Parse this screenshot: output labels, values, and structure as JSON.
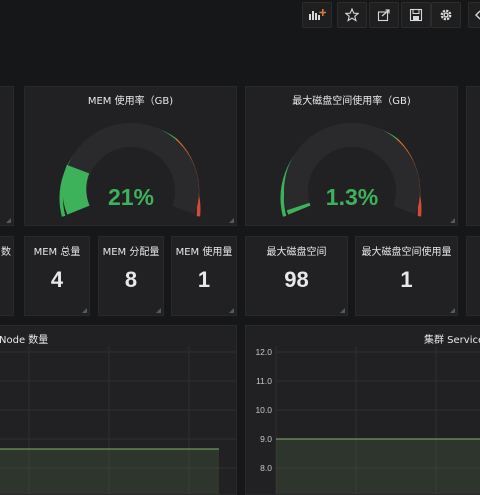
{
  "toolbar": {
    "buttons": [
      {
        "name": "add-panel-button",
        "icon": "add-panel-icon"
      },
      {
        "name": "star-button",
        "icon": "star-icon"
      },
      {
        "name": "share-button",
        "icon": "share-icon"
      },
      {
        "name": "save-button",
        "icon": "save-icon"
      },
      {
        "name": "settings-button",
        "icon": "gear-icon"
      },
      {
        "name": "back-button",
        "icon": "chevron-left-icon"
      }
    ]
  },
  "gauges": [
    {
      "title": "MEM 使用率（GB)",
      "value_text": "21%",
      "value": 21,
      "color": "#3eb15b"
    },
    {
      "title": "最大磁盘空间使用率（GB)",
      "value_text": "1.3%",
      "value": 1.3,
      "color": "#3eb15b"
    }
  ],
  "stats": [
    {
      "title": "数",
      "value": ""
    },
    {
      "title": "MEM 总量",
      "value": "4"
    },
    {
      "title": "MEM 分配量",
      "value": "8"
    },
    {
      "title": "MEM 使用量",
      "value": "1"
    },
    {
      "title": "最大磁盘空间",
      "value": "98"
    },
    {
      "title": "最大磁盘空间使用量",
      "value": "1"
    }
  ],
  "graphs": [
    {
      "title": "Node 数量"
    },
    {
      "title": "集群 Service"
    }
  ],
  "colors": {
    "green": "#3eb15b",
    "orange": "#e0752d",
    "red": "#d44a3a",
    "graph_line": "#7eb26d"
  },
  "chart_data": {
    "type": "line",
    "title": "集群 Service",
    "y_ticks": [
      "12.0",
      "11.0",
      "10.0",
      "9.0",
      "8.0"
    ],
    "ylim": [
      8,
      12
    ],
    "series": [
      {
        "values": [
          9,
          9,
          9,
          9,
          9,
          9
        ]
      }
    ]
  }
}
